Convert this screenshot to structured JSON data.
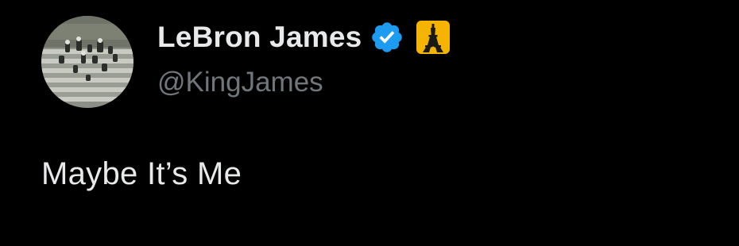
{
  "author": {
    "display_name": "LeBron James",
    "handle": "@KingJames",
    "verified_badge_icon": "verified-badge-icon",
    "verified_color": "#1d9bf0",
    "flag_emoji_icon": "eiffel-tower-emoji-icon",
    "flag_emoji_bg": "#f4b400",
    "avatar_icon": "avatar-photo-bleachers"
  },
  "tweet": {
    "text": "Maybe It’s Me"
  },
  "colors": {
    "background": "#000000",
    "primary_text": "#e7e9ea",
    "secondary_text": "#71767b"
  }
}
